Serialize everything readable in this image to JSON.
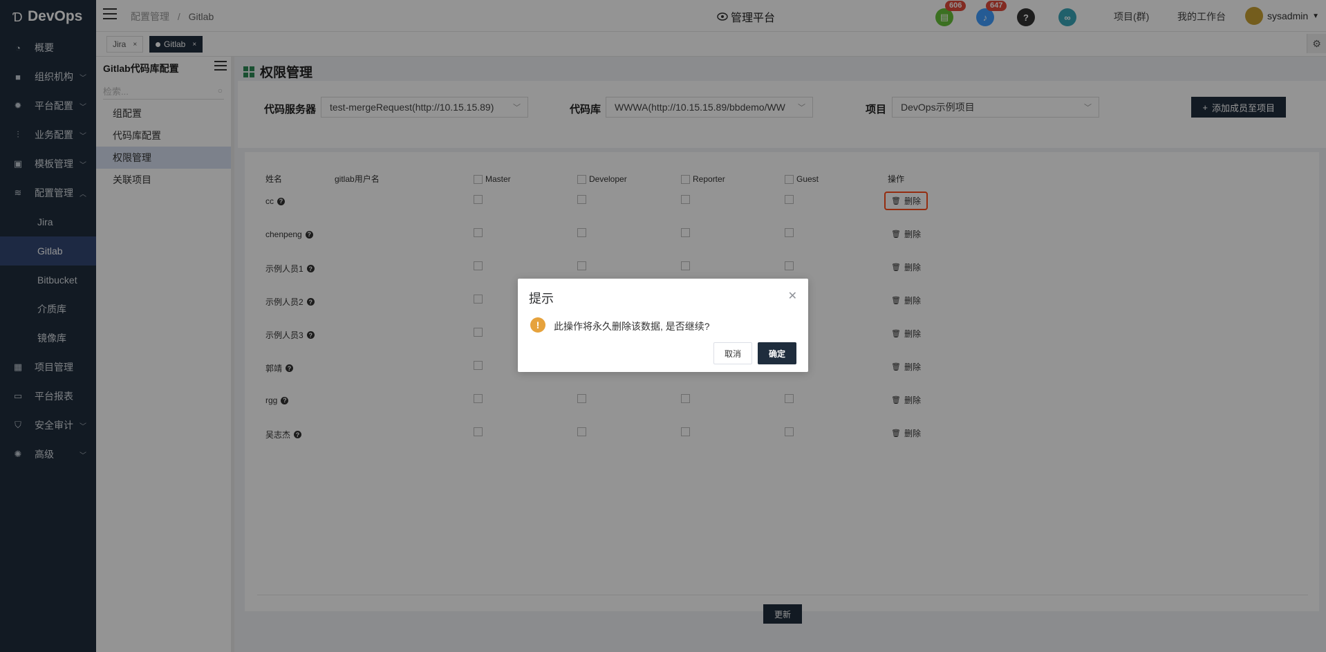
{
  "app": {
    "logo": "DevOps"
  },
  "sidebar": {
    "items": [
      {
        "label": "概要",
        "icon": "dashboard-icon",
        "chevron": ""
      },
      {
        "label": "组织机构",
        "icon": "lock-icon",
        "chevron": "﹀"
      },
      {
        "label": "平台配置",
        "icon": "gear-icon",
        "chevron": "﹀"
      },
      {
        "label": "业务配置",
        "icon": "sliders-icon",
        "chevron": "﹀"
      },
      {
        "label": "模板管理",
        "icon": "template-icon",
        "chevron": "﹀"
      },
      {
        "label": "配置管理",
        "icon": "database-icon",
        "chevron": "︿"
      },
      {
        "label": "Jira",
        "sub": true
      },
      {
        "label": "Gitlab",
        "sub": true,
        "active": true
      },
      {
        "label": "Bitbucket",
        "sub": true
      },
      {
        "label": "介质库",
        "sub": true
      },
      {
        "label": "镜像库",
        "sub": true
      },
      {
        "label": "项目管理",
        "icon": "grid-icon",
        "chevron": ""
      },
      {
        "label": "平台报表",
        "icon": "monitor-icon",
        "chevron": ""
      },
      {
        "label": "安全审计",
        "icon": "shield-icon",
        "chevron": "﹀"
      },
      {
        "label": "高级",
        "icon": "advanced-icon",
        "chevron": "﹀"
      }
    ]
  },
  "header": {
    "breadcrumb_parent": "配置管理",
    "breadcrumb_sep": "/",
    "breadcrumb_current": "Gitlab",
    "center_title": "管理平台",
    "badge_tasks": "606",
    "badge_notifications": "647",
    "link_projects": "项目(群)",
    "link_workbench": "我的工作台",
    "user": "sysadmin"
  },
  "tabs": [
    {
      "label": "Jira"
    },
    {
      "label": "Gitlab"
    }
  ],
  "panel2": {
    "title": "Gitlab代码库配置",
    "search_placeholder": "检索...",
    "items": [
      "组配置",
      "代码库配置",
      "权限管理",
      "关联项目"
    ]
  },
  "main": {
    "title": "权限管理",
    "filters": {
      "server_label": "代码服务器",
      "server_value": "test-mergeRequest(http://10.15.15.89)",
      "repo_label": "代码库",
      "repo_value": "WWWA(http://10.15.15.89/bbdemo/WW",
      "project_label": "项目",
      "project_value": "DevOps示例项目",
      "add_button": "添加成员至项目"
    },
    "table": {
      "headers": {
        "name": "姓名",
        "gitlab_user": "gitlab用户名",
        "master": "Master",
        "developer": "Developer",
        "reporter": "Reporter",
        "guest": "Guest",
        "action": "操作"
      },
      "rows": [
        {
          "name": "cc",
          "action": "删除"
        },
        {
          "name": "chenpeng",
          "action": "删除"
        },
        {
          "name": "示例人员1",
          "action": "删除"
        },
        {
          "name": "示例人员2",
          "action": "删除"
        },
        {
          "name": "示例人员3",
          "action": "删除"
        },
        {
          "name": "郭靖",
          "action": "删除"
        },
        {
          "name": "rgg",
          "action": "删除"
        },
        {
          "name": "吴志杰",
          "action": "删除"
        }
      ]
    },
    "update_button": "更新"
  },
  "dialog": {
    "title": "提示",
    "message": "此操作将永久删除该数据, 是否继续?",
    "cancel": "取消",
    "confirm": "确定"
  },
  "colors": {
    "sidebar": "#1f2d3d",
    "active": "#324874",
    "accent_green": "#2e8b57",
    "warning": "#e6a23c",
    "highlight": "#ff4d1a"
  }
}
